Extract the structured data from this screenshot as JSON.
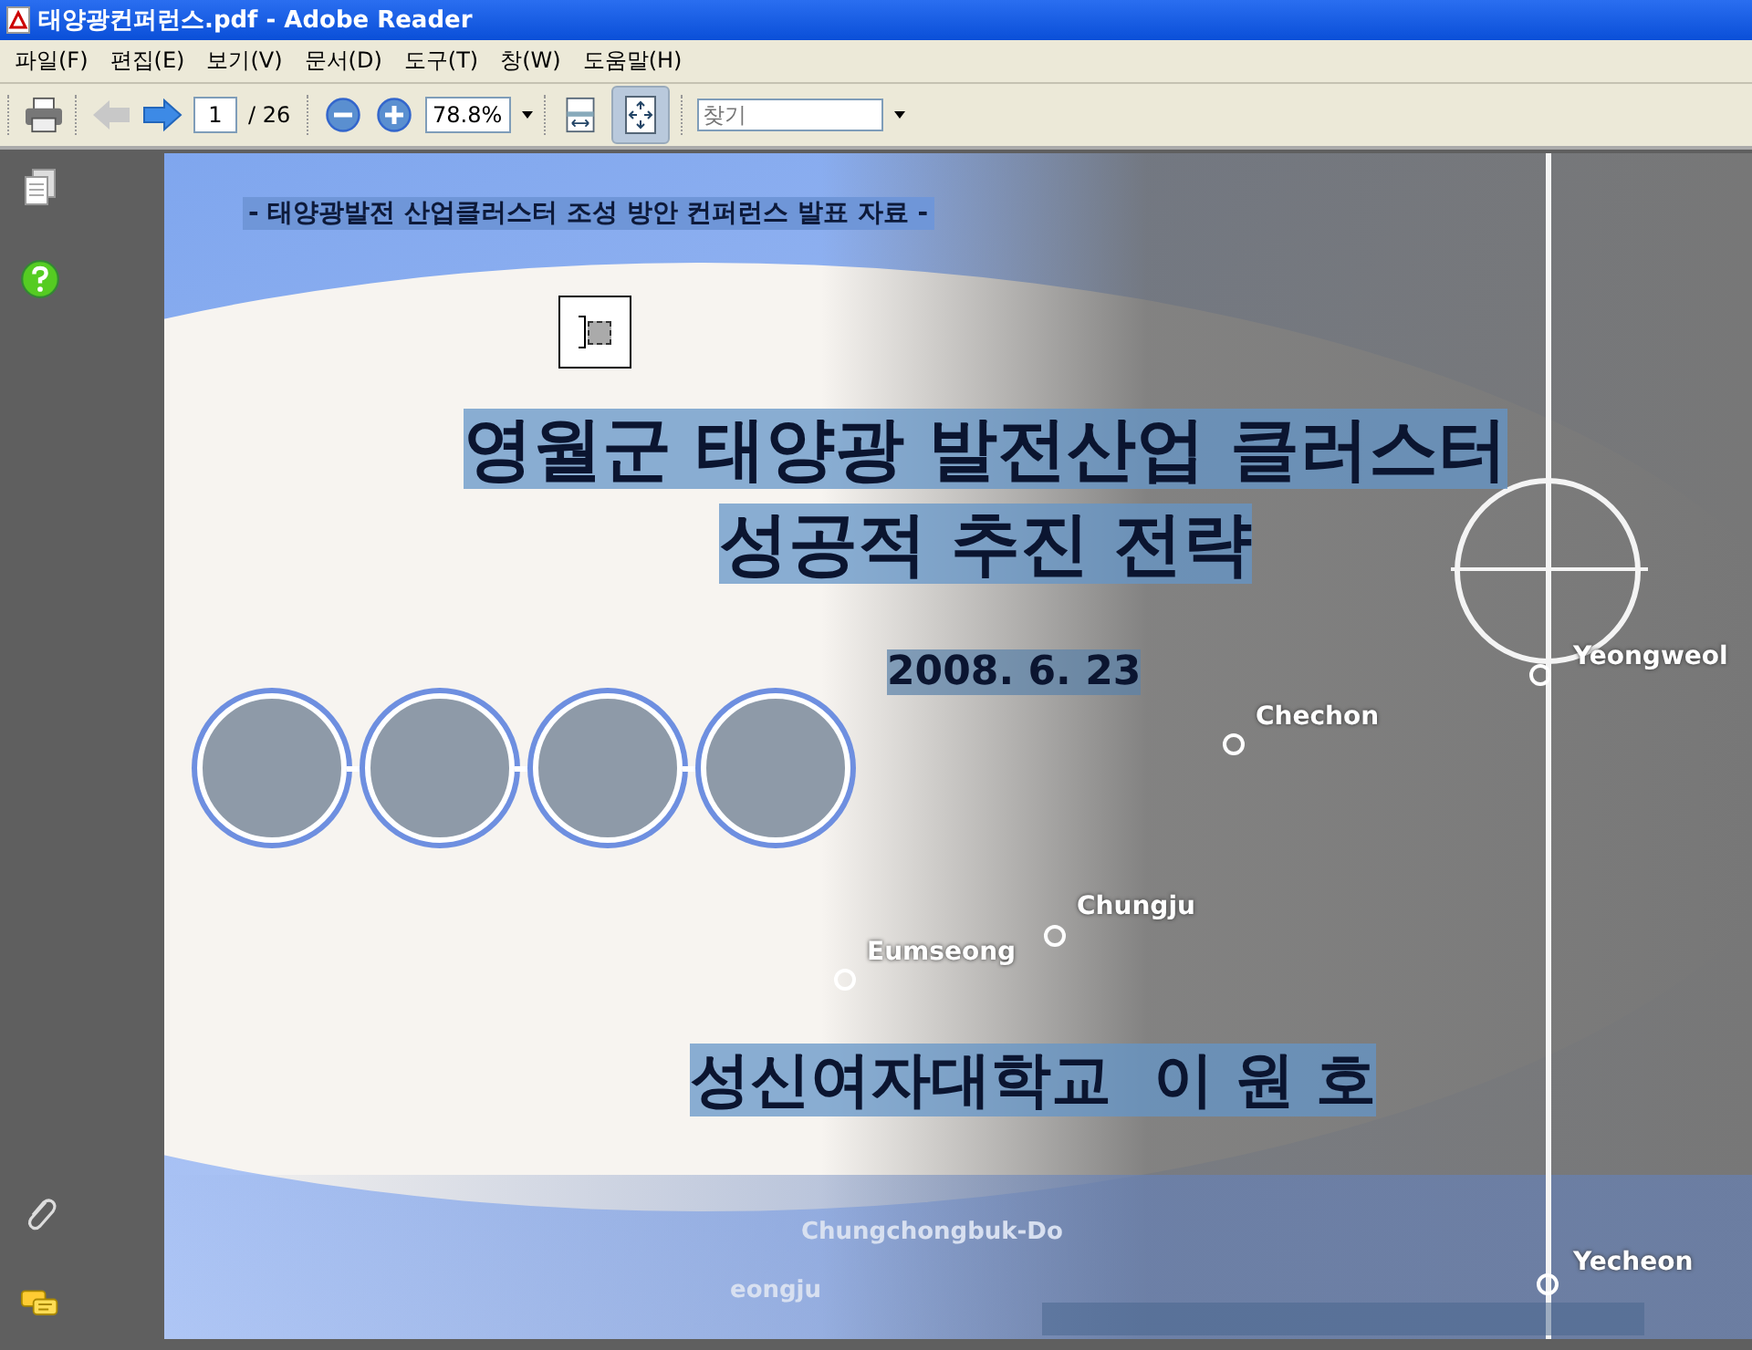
{
  "window": {
    "title": "태양광컨퍼런스.pdf - Adobe Reader"
  },
  "menu": [
    {
      "label": "파일(F)"
    },
    {
      "label": "편집(E)"
    },
    {
      "label": "보기(V)"
    },
    {
      "label": "문서(D)"
    },
    {
      "label": "도구(T)"
    },
    {
      "label": "창(W)"
    },
    {
      "label": "도움말(H)"
    }
  ],
  "toolbar": {
    "page": "1",
    "page_total": "/ 26",
    "zoom": "78.8%",
    "find_placeholder": "찾기",
    "back_disabled": true,
    "fit_page_selected": true
  },
  "slide": {
    "subtitle": "- 태양광발전 산업클러스터 조성 방안 컨퍼런스 발표 자료 -",
    "title_lines": [
      "영월군 태양광 발전산업 클러스터",
      "성공적 추진 전략"
    ],
    "date": "2008. 6. 23",
    "author": "성신여자대학교  이 원 호",
    "photos": [
      {
        "kind": "photo"
      },
      {
        "kind": "photo"
      },
      {
        "kind": "photo"
      },
      {
        "kind": "photo"
      }
    ],
    "map_labels": [
      {
        "text": "Yeongweol"
      },
      {
        "text": "Chechon"
      },
      {
        "text": "Chungju"
      },
      {
        "text": "Eumseong"
      },
      {
        "text": "Chungchongbuk-Do"
      },
      {
        "text": "Yecheon"
      },
      {
        "text": "eongju"
      }
    ]
  }
}
